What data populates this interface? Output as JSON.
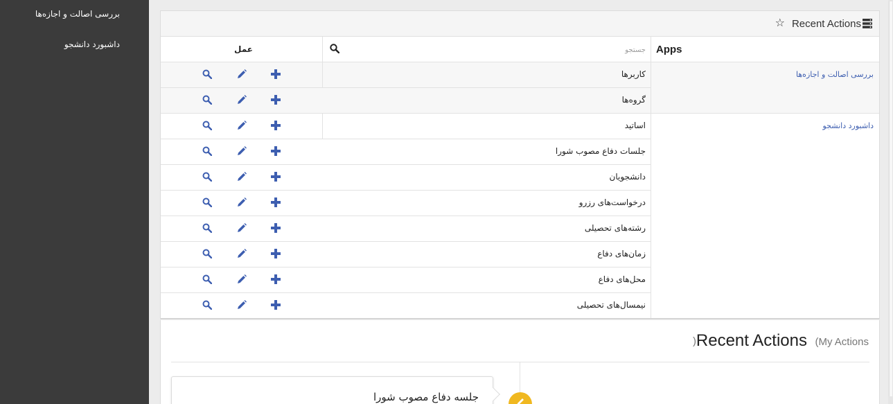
{
  "sidebar": {
    "items": [
      {
        "label": "بررسی اصالت و اجازه‌ها"
      },
      {
        "label": "داشبورد دانشجو"
      }
    ]
  },
  "panel": {
    "title": "Recent Actions",
    "columns": {
      "apps": "Apps",
      "search_placeholder": "جستجو",
      "search_value": "",
      "action": "عمل"
    },
    "apps": [
      {
        "name": "بررسی اصالت و اجازه‌ها",
        "models": [
          "کاربرها",
          "گروه‌ها"
        ]
      },
      {
        "name": "داشبورد دانشجو",
        "models": [
          "اساتید",
          "جلسات دفاع مصوب شورا",
          "دانشجویان",
          "درخواست‌های رزرو",
          "رشته‌های تحصیلی",
          "زمان‌های دفاع",
          "محل‌های دفاع",
          "نیمسال‌های تحصیلی"
        ]
      }
    ]
  },
  "recent_actions": {
    "title": "Recent Actions",
    "subtitle": "(My Actions",
    "subtitle_close": ")",
    "entries": [
      {
        "text": "جلسه دفاع مصوب شورا"
      }
    ]
  },
  "colors": {
    "sidebar_bg": "#3b3b3b",
    "link": "#3d5eb0",
    "action_icon": "#3d5eb0",
    "edit_badge": "#f0b820"
  },
  "icons": {
    "title": "menu-icon",
    "favorite": "star-icon",
    "search": "search-icon",
    "add": "plus-icon",
    "change": "pencil-icon",
    "view": "magnifier-icon"
  }
}
